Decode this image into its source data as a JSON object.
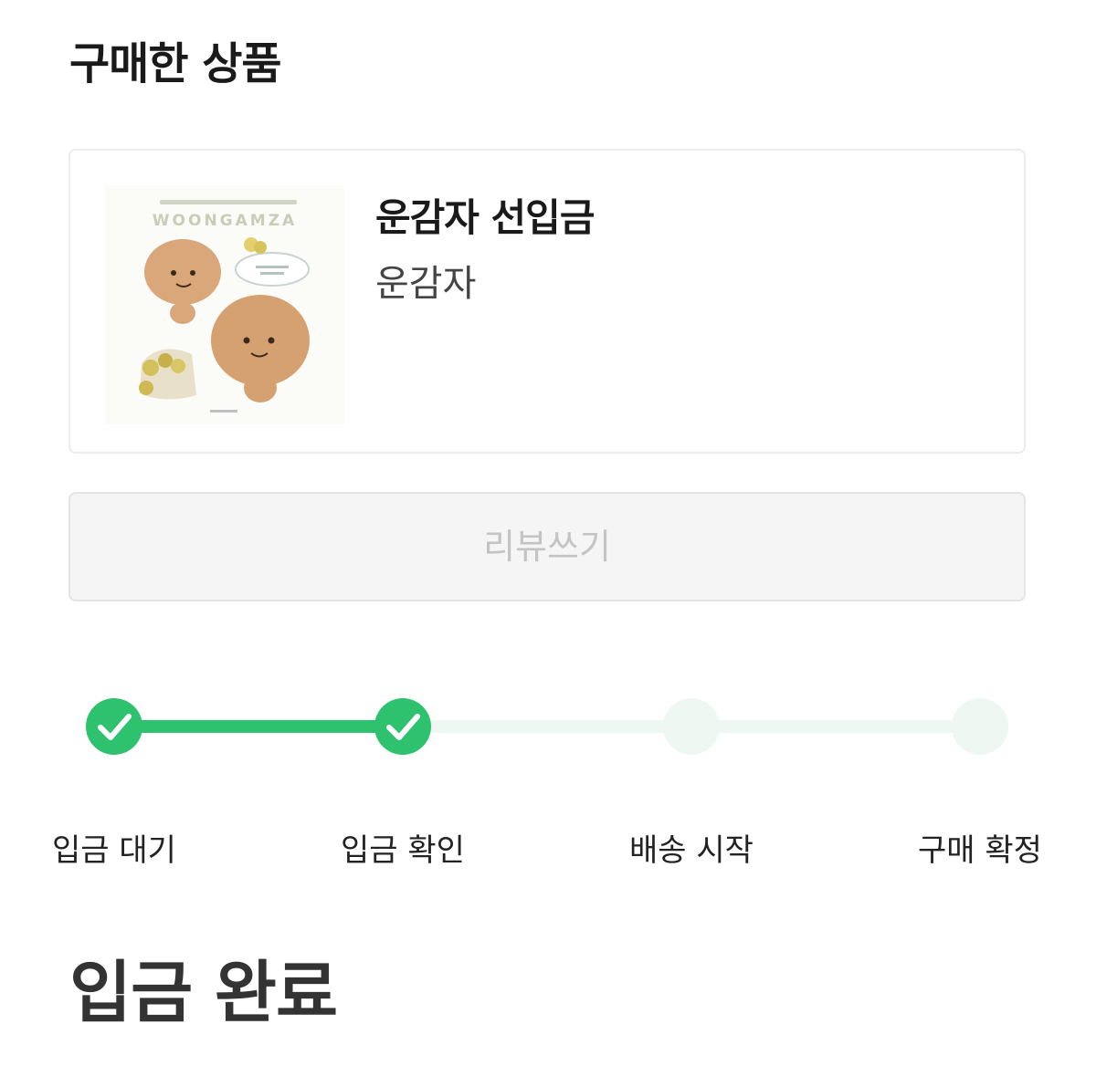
{
  "section": {
    "title": "구매한 상품"
  },
  "product": {
    "name": "운감자 선입금",
    "seller": "운감자",
    "thumbnail_icon": "product-image",
    "thumbnail_text": "WOONGAMZA"
  },
  "review_button": {
    "label": "리뷰쓰기"
  },
  "progress": {
    "accent_color": "#2ec26f",
    "inactive_color": "#eef7f1",
    "steps": [
      {
        "label": "입금 대기",
        "done": true
      },
      {
        "label": "입금 확인",
        "done": true
      },
      {
        "label": "배송 시작",
        "done": false
      },
      {
        "label": "구매 확정",
        "done": false
      }
    ]
  },
  "status": {
    "title": "입금 완료"
  }
}
